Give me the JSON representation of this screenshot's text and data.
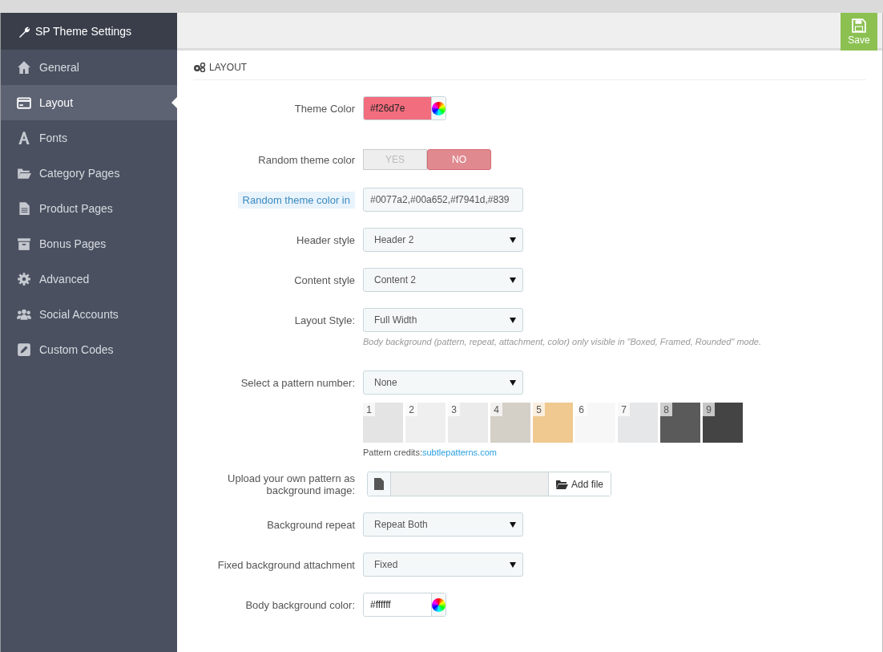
{
  "sidebar": {
    "title": "SP Theme Settings",
    "items": [
      {
        "label": "General",
        "selected": false
      },
      {
        "label": "Layout",
        "selected": true
      },
      {
        "label": "Fonts",
        "selected": false
      },
      {
        "label": "Category Pages",
        "selected": false
      },
      {
        "label": "Product Pages",
        "selected": false
      },
      {
        "label": "Bonus Pages",
        "selected": false
      },
      {
        "label": "Advanced",
        "selected": false
      },
      {
        "label": "Social Accounts",
        "selected": false
      },
      {
        "label": "Custom Codes",
        "selected": false
      }
    ]
  },
  "toolbar": {
    "save_label": "Save"
  },
  "section": {
    "title": "LAYOUT",
    "fields": [
      {
        "kind": "color",
        "label": "Theme Color",
        "value": "#f26d7e",
        "color": "#f26d7e"
      },
      {
        "kind": "toggle",
        "label": "Random theme color",
        "options": [
          {
            "label": "YES",
            "selected": false
          },
          {
            "label": "NO",
            "selected": true
          }
        ]
      },
      {
        "kind": "text",
        "label": "Random theme color in",
        "highlighted": true,
        "value": "#0077a2,#00a652,#f7941d,#839"
      },
      {
        "kind": "select",
        "label": "Header style",
        "value": "Header 2"
      },
      {
        "kind": "select",
        "label": "Content style",
        "value": "Content 2"
      },
      {
        "kind": "select",
        "label": "Layout Style:",
        "value": "Full Width",
        "help": "Body background (pattern, repeat, attachment, color) only visible in \"Boxed, Framed, Rounded\" mode."
      },
      {
        "kind": "patterns",
        "label": "Select a pattern number:",
        "value": "None",
        "patterns": [
          {
            "number": "1",
            "color": "#e4e4e4"
          },
          {
            "number": "2",
            "color": "#efefef"
          },
          {
            "number": "3",
            "color": "#ebebeb"
          },
          {
            "number": "4",
            "color": "#d4d0c8"
          },
          {
            "number": "5",
            "color": "#efc98f"
          },
          {
            "number": "6",
            "color": "#f7f7f7"
          },
          {
            "number": "7",
            "color": "#e6e7e9"
          },
          {
            "number": "8",
            "color": "#5a5a5a"
          },
          {
            "number": "9",
            "color": "#444444"
          }
        ],
        "credits_label": "Pattern credits:",
        "credits_link": "subtlepatterns.com"
      },
      {
        "kind": "file",
        "label": "Upload your own pattern as background image:",
        "button": "Add file"
      },
      {
        "kind": "select",
        "label": "Background repeat",
        "value": "Repeat Both"
      },
      {
        "kind": "select",
        "label": "Fixed background attachment",
        "value": "Fixed"
      },
      {
        "kind": "color",
        "label": "Body background color:",
        "value": "#ffffff",
        "color": "#ffffff"
      }
    ]
  }
}
